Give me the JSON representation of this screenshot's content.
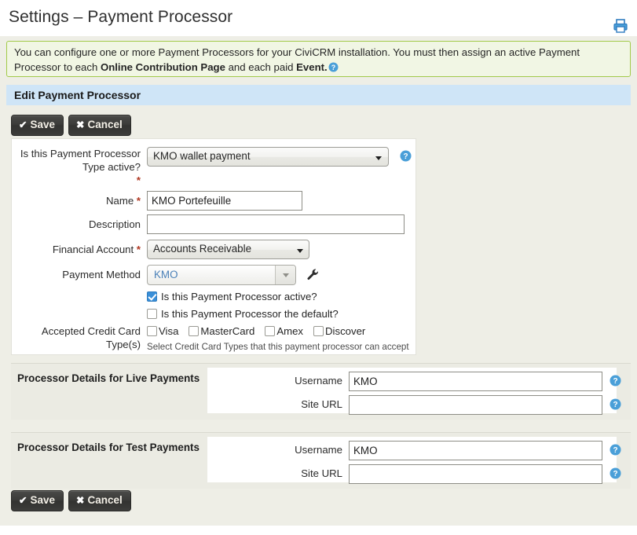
{
  "header": {
    "title": "Settings – Payment Processor",
    "print_icon": "print-icon"
  },
  "banner": {
    "text_part1": "You can configure one or more Payment Processors for your CiviCRM installation. You must then assign an active Payment Processor to each ",
    "bold1": "Online Contribution Page",
    "text_part2": " and each paid ",
    "bold2": "Event.",
    "help_icon": "help-icon"
  },
  "section_header": {
    "title": "Edit Payment Processor"
  },
  "buttons": {
    "save_label": "Save",
    "cancel_label": "Cancel",
    "save_icon": "check-icon",
    "cancel_icon": "close-icon"
  },
  "form": {
    "processor_type": {
      "label": "Is this Payment Processor Type active?",
      "required": "*",
      "value": "KMO wallet payment",
      "help_icon": "help-icon"
    },
    "name": {
      "label": "Name",
      "required": "*",
      "value": "KMO Portefeuille"
    },
    "description": {
      "label": "Description",
      "value": ""
    },
    "financial_account": {
      "label": "Financial Account",
      "required": "*",
      "value": "Accounts Receivable"
    },
    "payment_method": {
      "label": "Payment Method",
      "value": "KMO",
      "edit_icon": "wrench-icon"
    },
    "is_active": {
      "label": "Is this Payment Processor active?",
      "checked": true
    },
    "is_default": {
      "label": "Is this Payment Processor the default?",
      "checked": false
    },
    "credit_cards": {
      "label_line1": "Accepted Credit Card",
      "label_line2": "Type(s)",
      "options": [
        {
          "label": "Visa",
          "checked": false
        },
        {
          "label": "MasterCard",
          "checked": false
        },
        {
          "label": "Amex",
          "checked": false
        },
        {
          "label": "Discover",
          "checked": false
        }
      ],
      "hint": "Select Credit Card Types that this payment processor can accept"
    }
  },
  "live_section": {
    "title": "Processor Details for Live Payments",
    "fields": [
      {
        "label": "Username",
        "value": "KMO",
        "help_icon": "help-icon"
      },
      {
        "label": "Site URL",
        "value": "",
        "help_icon": "help-icon"
      }
    ]
  },
  "test_section": {
    "title": "Processor Details for Test Payments",
    "fields": [
      {
        "label": "Username",
        "value": "KMO",
        "help_icon": "help-icon"
      },
      {
        "label": "Site URL",
        "value": "",
        "help_icon": "help-icon"
      }
    ]
  },
  "colors": {
    "page_bg": "#eeeee6",
    "banner_bg": "#f1f6e4",
    "banner_border": "#a2ca4a",
    "section_header_bg": "#cfe5f7",
    "button_bg": "#3a3a38",
    "accent_blue": "#3a8fd8",
    "link_blue": "#4a80b8",
    "required_red": "#b03721"
  }
}
